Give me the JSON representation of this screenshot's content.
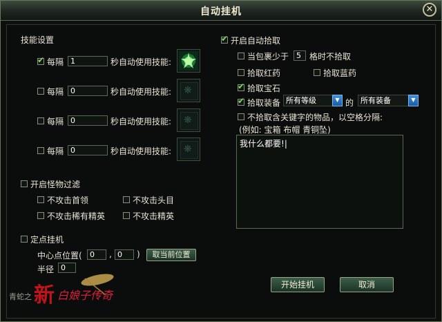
{
  "window": {
    "title": "自动挂机",
    "close_label": "✕"
  },
  "skills": {
    "heading": "技能设置",
    "rows": [
      {
        "checked": true,
        "prefix": "每隔",
        "value": "1",
        "suffix": "秒自动使用技能:",
        "has_icon": true
      },
      {
        "checked": false,
        "prefix": "每隔",
        "value": "0",
        "suffix": "秒自动使用技能:",
        "has_icon": false
      },
      {
        "checked": false,
        "prefix": "每隔",
        "value": "0",
        "suffix": "秒自动使用技能:",
        "has_icon": false
      },
      {
        "checked": false,
        "prefix": "每隔",
        "value": "0",
        "suffix": "秒自动使用技能:",
        "has_icon": false
      }
    ]
  },
  "monster_filter": {
    "label": "开启怪物过滤",
    "options": [
      "不攻击首领",
      "不攻击头目",
      "不攻击稀有精英",
      "不攻击精英"
    ]
  },
  "fixed_point": {
    "label": "定点挂机",
    "center_label": "中心点位置(",
    "x": "0",
    "comma": ",",
    "y": "0",
    "close_paren": ")",
    "current_button": "取当前位置",
    "radius_label": "半径",
    "radius": "0"
  },
  "pickup": {
    "label": "开启自动拾取",
    "bag_prefix": "当包裹少于",
    "bag_value": "5",
    "bag_suffix": "格时不拾取",
    "red": "拾取红药",
    "blue": "拾取蓝药",
    "gem": "拾取宝石",
    "equip": "拾取装备",
    "level_select": "所有等级",
    "of": "的",
    "type_select": "所有装备",
    "keyword_label": "不拾取含关键字的物品，以空格分隔:",
    "keyword_example": "(例如: 宝箱 布帽 青铜坠)",
    "keyword_text": "我什么都要!"
  },
  "buttons": {
    "start": "开始挂机",
    "cancel": "取消"
  },
  "logo": {
    "text": "新白娘子传奇",
    "small": "青蛇之"
  },
  "colors": {
    "check": "#7fdc62",
    "accent_blue": "#2f7fd0",
    "logo_red": "#c0141a"
  }
}
